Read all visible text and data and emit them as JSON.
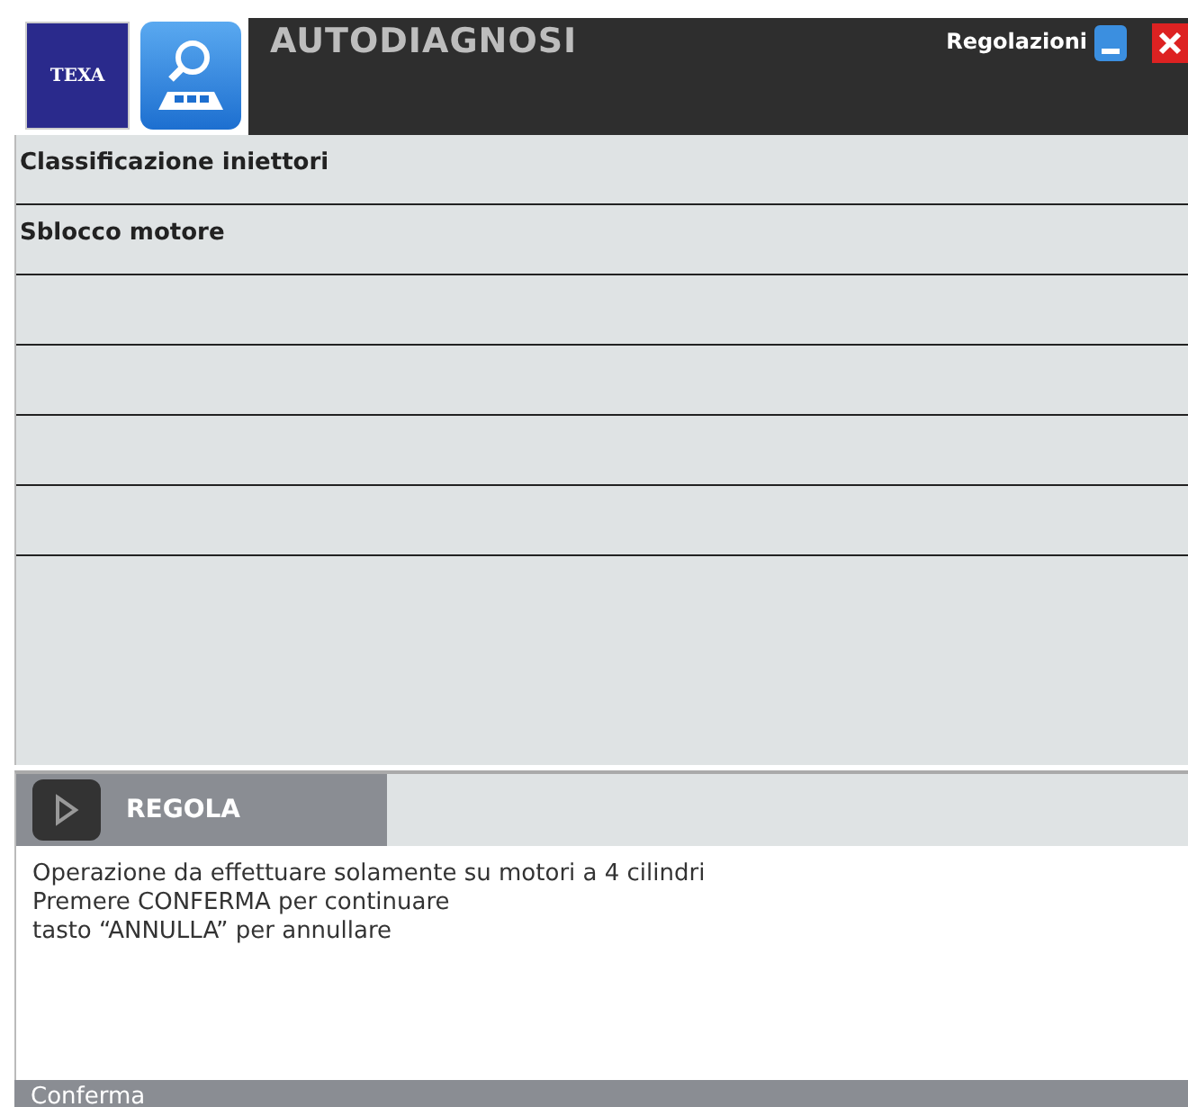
{
  "header": {
    "logo": "TEXA",
    "title": "AUTODIAGNOSI",
    "settings": "Regolazioni"
  },
  "menu_items": [
    {
      "label": "Classificazione iniettori"
    },
    {
      "label": "Sblocco motore"
    }
  ],
  "action_bar": {
    "label": "REGOLA"
  },
  "message": [
    "Operazione da effettuare solamente su motori a 4 cilindri",
    "Premere CONFERMA per continuare",
    "tasto “ANNULLA” per annullare"
  ],
  "footer": {
    "label": "Conferma"
  }
}
